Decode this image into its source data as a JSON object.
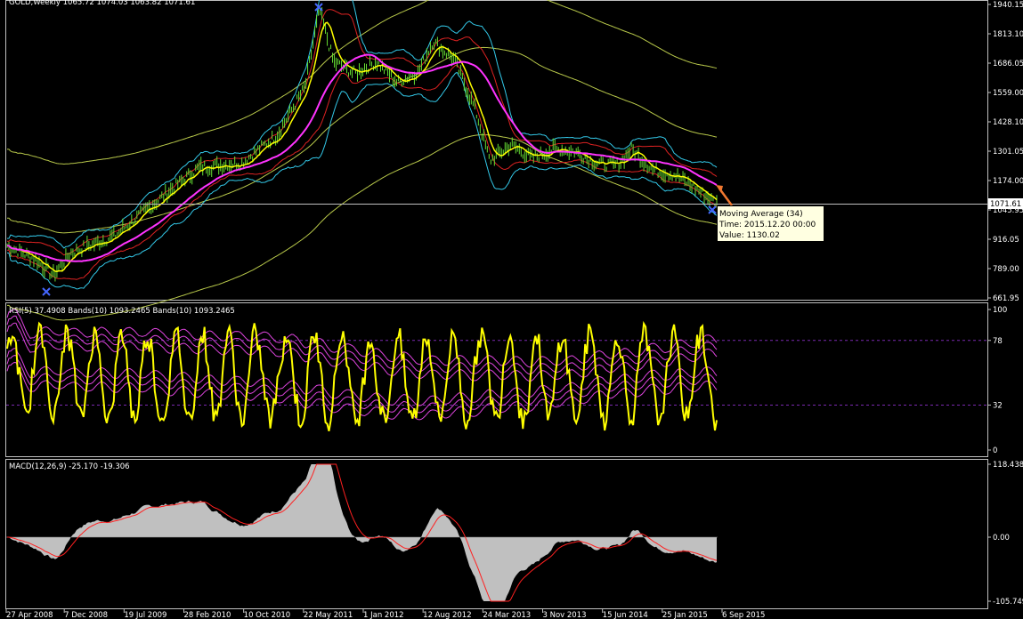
{
  "colors": {
    "background": "#000000",
    "frame": "#c0c0c0",
    "price_bars": "#66dd33",
    "ma_fast": "#ffff00",
    "ma_slow": "#ff33ff",
    "bb_outer": "#33c8e8",
    "bb_inner": "#dd2222",
    "envelope": "#b8c84a",
    "rsi": "#ffff00",
    "rsi_bands": "#dd44dd",
    "macd_hist": "#c0c0c0",
    "macd_signal": "#ff2020",
    "level_line": "#7a2ab0",
    "tooltip_bg": "#ffffe1",
    "tooltip_arrow": "#f07830",
    "arrow_marker": "#4466ff"
  },
  "header": {
    "price_title": "GOLD,Weekly  1065.72 1074.03 1063.82 1071.61",
    "rsi_title": "RSI(5) 37.4908  Bands(10) 1093.2465  Bands(10) 1093.2465",
    "macd_title": "MACD(12,26,9) -25.170 -19.306"
  },
  "price_axis": {
    "ticks": [
      "1940.15",
      "1813.10",
      "1686.05",
      "1559.00",
      "1428.10",
      "1301.05",
      "1174.00",
      "1045.95",
      "916.05",
      "789.00",
      "661.95"
    ],
    "current_price": "1071.61"
  },
  "rsi_axis": {
    "ticks": [
      "100",
      "78",
      "32",
      "0"
    ]
  },
  "macd_axis": {
    "ticks": [
      "118.438",
      "0.00",
      "-105.749"
    ]
  },
  "time_axis": {
    "labels": [
      "27 Apr 2008",
      "7 Dec 2008",
      "19 Jul 2009",
      "28 Feb 2010",
      "10 Oct 2010",
      "22 May 2011",
      "1 Jan 2012",
      "12 Aug 2012",
      "24 Mar 2013",
      "3 Nov 2013",
      "15 Jun 2014",
      "25 Jan 2015",
      "6 Sep 2015"
    ]
  },
  "tooltip": {
    "line1": "Moving Average (34)",
    "line2": "Time: 2015.12.20 00:00",
    "line3": "Value: 1130.02"
  },
  "chart_data": [
    {
      "type": "line",
      "title": "GOLD,Weekly",
      "ohlc": {
        "open": 1065.72,
        "high": 1074.03,
        "low": 1063.82,
        "close": 1071.61
      },
      "ylim": [
        661.95,
        1940.15
      ],
      "x": [
        "27 Apr 2008",
        "7 Dec 2008",
        "19 Jul 2009",
        "28 Feb 2010",
        "10 Oct 2010",
        "22 May 2011",
        "1 Jan 2012",
        "12 Aug 2012",
        "24 Mar 2013",
        "3 Nov 2013",
        "15 Jun 2014",
        "25 Jan 2015",
        "6 Sep 2015"
      ],
      "series": [
        {
          "name": "Moving Average (34)",
          "values": [
            880,
            860,
            920,
            1060,
            1200,
            1420,
            1640,
            1650,
            1570,
            1320,
            1260,
            1210,
            1140
          ]
        }
      ],
      "close_estimate": [
        890,
        780,
        950,
        1120,
        1340,
        1500,
        1590,
        1680,
        1560,
        1270,
        1280,
        1220,
        1120
      ]
    },
    {
      "type": "line",
      "title": "RSI(5) 37.4908",
      "ylim": [
        0,
        100
      ],
      "levels": [
        78,
        32
      ],
      "last_value": 37.4908,
      "bands_value": 1093.2465
    },
    {
      "type": "bar",
      "title": "MACD(12,26,9)",
      "ylim": [
        -105.749,
        118.438
      ],
      "macd_last": -25.17,
      "signal_last": -19.306,
      "x": [
        "27 Apr 2008",
        "7 Dec 2008",
        "19 Jul 2009",
        "28 Feb 2010",
        "10 Oct 2010",
        "22 May 2011",
        "1 Jan 2012",
        "12 Aug 2012",
        "24 Mar 2013",
        "3 Nov 2013",
        "15 Jun 2014",
        "25 Jan 2015",
        "6 Sep 2015"
      ],
      "values": [
        5,
        -35,
        25,
        35,
        30,
        80,
        25,
        -10,
        -75,
        -15,
        -5,
        -12,
        -20
      ]
    }
  ]
}
